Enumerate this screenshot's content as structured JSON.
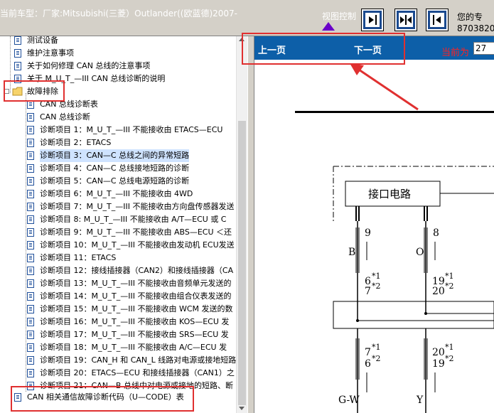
{
  "header": {
    "car_title": "当前车型：厂家:Mitsubishi(三菱）Outlander((欧蓝德)2007-",
    "view_control_label": "视图控制",
    "contact_line1": "您的专",
    "contact_line2": "8703820"
  },
  "toolbar": {
    "buttons": [
      {
        "icon": "expand-right-icon"
      },
      {
        "icon": "split-view-icon"
      },
      {
        "icon": "collapse-left-icon"
      }
    ]
  },
  "tree": {
    "items": [
      {
        "label": "测试设备",
        "level": 1
      },
      {
        "label": "维护注意事项",
        "level": 1
      },
      {
        "label": "关于如何修理 CAN 总线的注意事项",
        "level": 1
      },
      {
        "label": "关于 M_U_T_—III CAN 总线诊断的说明",
        "level": 1
      },
      {
        "label": "故障排除",
        "level": 0,
        "folder": true
      },
      {
        "label": "CAN 总线诊断表",
        "level": 2
      },
      {
        "label": "CAN 总线诊断",
        "level": 2
      },
      {
        "label": "诊断项目 1：M_U_T_—III 不能接收由 ETACS—ECU",
        "level": 2
      },
      {
        "label": "诊断项目 2：ETACS",
        "level": 2
      },
      {
        "label": "诊断项目 3：CAN—C 总线之间的异常短路",
        "level": 2,
        "selected": true
      },
      {
        "label": "诊断项目 4：CAN—C 总线接地短路的诊断",
        "level": 2
      },
      {
        "label": "诊断项目 5：CAN—C 总线电源短路的诊断",
        "level": 2
      },
      {
        "label": "诊断项目 6：M_U_T_—III 不能接收由 4WD",
        "level": 2
      },
      {
        "label": "诊断项目 7：M_U_T_—III 不能接收由方向盘传感器发送",
        "level": 2
      },
      {
        "label": "诊断项目 8: M_U_T_—III 不能接收由 A/T—ECU 或 C",
        "level": 2
      },
      {
        "label": "诊断项目 9：M_U_T_—III 不能接收由 ABS—ECU ＜还",
        "level": 2
      },
      {
        "label": "诊断项目 10：M_U_T_—III 不能接收由发动机 ECU发送",
        "level": 2
      },
      {
        "label": "诊断项目 11：ETACS",
        "level": 2
      },
      {
        "label": "诊断项目 12：接线插接器（CAN2）和接线插接器（CA",
        "level": 2
      },
      {
        "label": "诊断项目 13：M_U_T_—III 不能接收由音频单元发送的",
        "level": 2
      },
      {
        "label": "诊断项目 14：M_U_T_—III 不能接收由组合仪表发送的",
        "level": 2
      },
      {
        "label": "诊断项目 15：M_U_T_—III 不能接收由 WCM 发送的数",
        "level": 2
      },
      {
        "label": "诊断项目 16：M_U_T_—III 不能接收由 KOS—ECU 发",
        "level": 2
      },
      {
        "label": "诊断项目 17：M_U_T_—III 不能接收由 SRS—ECU 发",
        "level": 2
      },
      {
        "label": "诊断项目 18：M_U_T_—III 不能接收由 A/C—ECU 发",
        "level": 2
      },
      {
        "label": "诊断项目 19：CAN_H 和 CAN_L 线路对电源或接地短路",
        "level": 2
      },
      {
        "label": "诊断项目 20：ETACS—ECU 和接线插接器（CAN1）之",
        "level": 2
      },
      {
        "label": "诊断项目 21：CAN—B 总线中对电源或接地的短路、断",
        "level": 2
      },
      {
        "label": "CAN 相关通信故障诊断代码（U—CODE）表",
        "level": 1
      }
    ]
  },
  "nav": {
    "prev_label": "上一页",
    "next_label": "下一页",
    "current_label": "当前为",
    "current_page": "27"
  },
  "diagram": {
    "box_label": "接口电路",
    "pin_left": "9",
    "pin_right": "8",
    "wire_left_color": "B",
    "wire_right_color": "O",
    "conn_upper_left_1": "6",
    "conn_upper_left_2": "7",
    "conn_upper_right_1": "19",
    "conn_upper_right_2": "20",
    "conn_lower_left_1": "7",
    "conn_lower_left_2": "6",
    "conn_lower_right_1": "20",
    "conn_lower_right_2": "19",
    "mark_1": "*1",
    "mark_2": "*2",
    "wire_bottom_left": "G-W",
    "wire_bottom_right": "Y"
  },
  "colors": {
    "nav_blue": "#0d5fa8",
    "highlight_red": "#e03030",
    "selected_bg": "#cfe3ff"
  }
}
